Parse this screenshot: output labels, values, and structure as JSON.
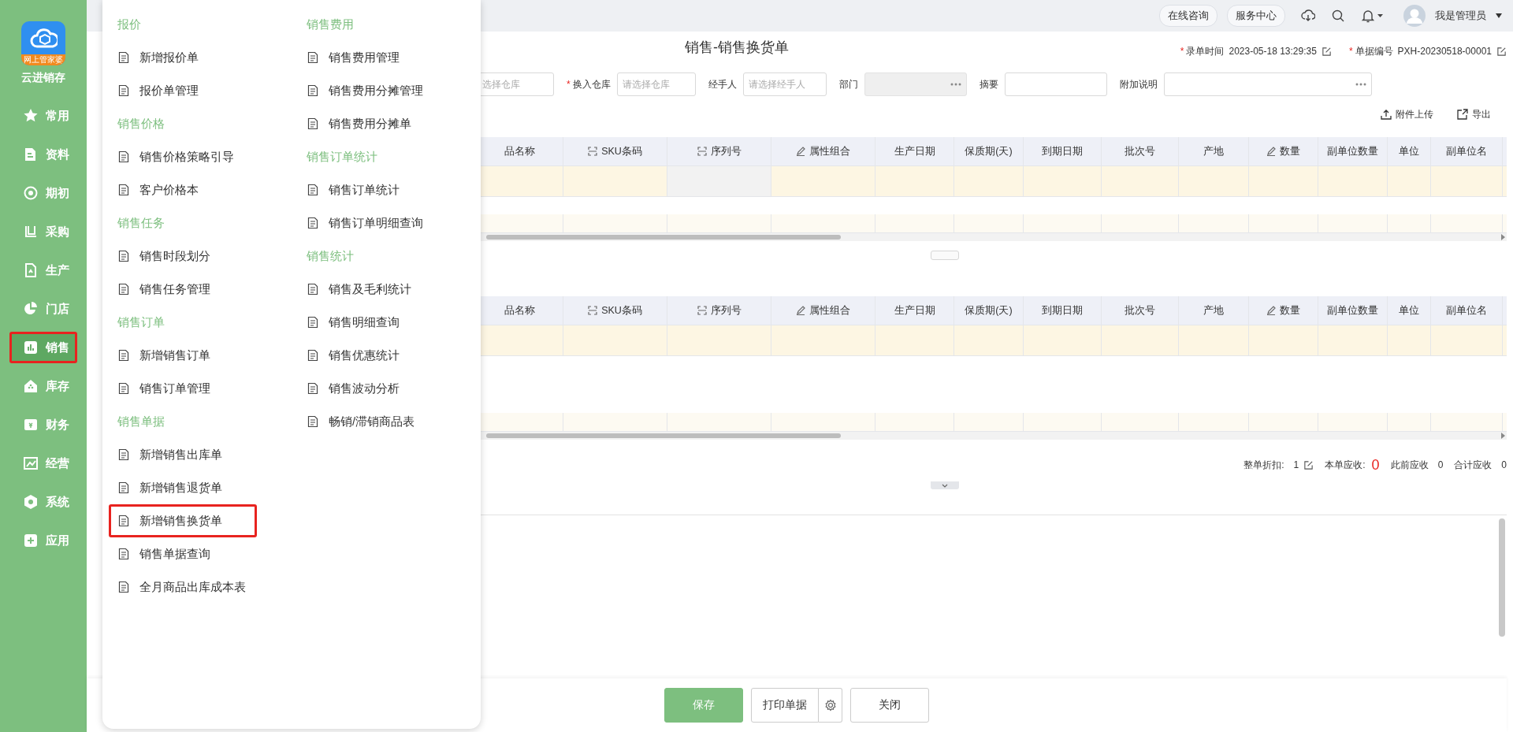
{
  "sidebar": {
    "logo_text": "网上管家婆",
    "brand": "云进销存",
    "items": [
      {
        "label": "常用",
        "selected": false,
        "highlighted": false
      },
      {
        "label": "资料",
        "selected": false,
        "highlighted": false
      },
      {
        "label": "期初",
        "selected": false,
        "highlighted": false
      },
      {
        "label": "采购",
        "selected": false,
        "highlighted": false
      },
      {
        "label": "生产",
        "selected": false,
        "highlighted": false
      },
      {
        "label": "门店",
        "selected": false,
        "highlighted": false
      },
      {
        "label": "销售",
        "selected": true,
        "highlighted": true
      },
      {
        "label": "库存",
        "selected": false,
        "highlighted": false
      },
      {
        "label": "财务",
        "selected": false,
        "highlighted": false
      },
      {
        "label": "经营",
        "selected": false,
        "highlighted": false
      },
      {
        "label": "系统",
        "selected": false,
        "highlighted": false
      },
      {
        "label": "应用",
        "selected": false,
        "highlighted": false
      }
    ]
  },
  "topbar": {
    "buttons": [
      "在线咨询",
      "服务中心"
    ],
    "user": "我是管理员"
  },
  "menu": {
    "columns": [
      {
        "groups": [
          {
            "title": "报价",
            "items": [
              {
                "label": "新增报价单",
                "highlighted": false
              },
              {
                "label": "报价单管理",
                "highlighted": false
              }
            ]
          },
          {
            "title": "销售价格",
            "items": [
              {
                "label": "销售价格策略引导",
                "highlighted": false
              },
              {
                "label": "客户价格本",
                "highlighted": false
              }
            ]
          },
          {
            "title": "销售任务",
            "items": [
              {
                "label": "销售时段划分",
                "highlighted": false
              },
              {
                "label": "销售任务管理",
                "highlighted": false
              }
            ]
          },
          {
            "title": "销售订单",
            "items": [
              {
                "label": "新增销售订单",
                "highlighted": false
              },
              {
                "label": "销售订单管理",
                "highlighted": false
              }
            ]
          },
          {
            "title": "销售单据",
            "items": [
              {
                "label": "新增销售出库单",
                "highlighted": false
              },
              {
                "label": "新增销售退货单",
                "highlighted": false
              },
              {
                "label": "新增销售换货单",
                "highlighted": true
              },
              {
                "label": "销售单据查询",
                "highlighted": false
              },
              {
                "label": "全月商品出库成本表",
                "highlighted": false
              }
            ]
          }
        ]
      },
      {
        "groups": [
          {
            "title": "销售费用",
            "items": [
              {
                "label": "销售费用管理",
                "highlighted": false
              },
              {
                "label": "销售费用分摊管理",
                "highlighted": false
              },
              {
                "label": "销售费用分摊单",
                "highlighted": false
              }
            ]
          },
          {
            "title": "销售订单统计",
            "items": [
              {
                "label": "销售订单统计",
                "highlighted": false
              },
              {
                "label": "销售订单明细查询",
                "highlighted": false
              }
            ]
          },
          {
            "title": "销售统计",
            "items": [
              {
                "label": "销售及毛利统计",
                "highlighted": false
              },
              {
                "label": "销售明细查询",
                "highlighted": false
              },
              {
                "label": "销售优惠统计",
                "highlighted": false
              },
              {
                "label": "销售波动分析",
                "highlighted": false
              },
              {
                "label": "畅销/滞销商品表",
                "highlighted": false
              }
            ]
          }
        ]
      }
    ]
  },
  "form": {
    "title": "销售-销售换货单",
    "meta": [
      {
        "mark": "*",
        "label": "录单时间",
        "value": "2023-05-18 13:29:35"
      },
      {
        "mark": "*",
        "label": "单据编号",
        "value": "PXH-20230518-00001"
      }
    ],
    "fields": [
      {
        "kind": "select",
        "placeholder": "选择仓库"
      },
      {
        "kind": "select",
        "mark": "*",
        "label": "换入仓库",
        "placeholder": "请选择仓库"
      },
      {
        "kind": "select",
        "label": "经手人",
        "placeholder": "请选择经手人"
      },
      {
        "kind": "picker",
        "label": "部门",
        "disabled": true
      },
      {
        "kind": "text",
        "label": "摘要",
        "disabled": false
      },
      {
        "kind": "picker",
        "label": "附加说明",
        "disabled": false
      }
    ],
    "actions": [
      {
        "label": "附件上传",
        "kind": "upload"
      },
      {
        "label": "导出",
        "kind": "export"
      }
    ]
  },
  "tables": [
    {
      "columns": [
        {
          "label": "品名称",
          "kind": "plain"
        },
        {
          "label": "SKU条码",
          "kind": "scan"
        },
        {
          "label": "序列号",
          "kind": "scan"
        },
        {
          "label": "属性组合",
          "kind": "edit"
        },
        {
          "label": "生产日期",
          "kind": "plain"
        },
        {
          "label": "保质期(天)",
          "kind": "plain"
        },
        {
          "label": "到期日期",
          "kind": "plain"
        },
        {
          "label": "批次号",
          "kind": "plain"
        },
        {
          "label": "产地",
          "kind": "plain"
        },
        {
          "label": "数量",
          "kind": "edit"
        },
        {
          "label": "副单位数量",
          "kind": "plain"
        },
        {
          "label": "单位",
          "kind": "plain"
        },
        {
          "label": "副单位名",
          "kind": "plain"
        }
      ]
    },
    {
      "columns": [
        {
          "label": "品名称",
          "kind": "plain"
        },
        {
          "label": "SKU条码",
          "kind": "scan"
        },
        {
          "label": "序列号",
          "kind": "scan"
        },
        {
          "label": "属性组合",
          "kind": "edit"
        },
        {
          "label": "生产日期",
          "kind": "plain"
        },
        {
          "label": "保质期(天)",
          "kind": "plain"
        },
        {
          "label": "到期日期",
          "kind": "plain"
        },
        {
          "label": "批次号",
          "kind": "plain"
        },
        {
          "label": "产地",
          "kind": "plain"
        },
        {
          "label": "数量",
          "kind": "edit"
        },
        {
          "label": "副单位数量",
          "kind": "plain"
        },
        {
          "label": "单位",
          "kind": "plain"
        },
        {
          "label": "副单位名",
          "kind": "plain"
        }
      ]
    }
  ],
  "summary": [
    {
      "label": "整单折扣:",
      "value": "1",
      "kind": "editable"
    },
    {
      "label": "本单应收:",
      "value": "0",
      "kind": "highlight"
    },
    {
      "label": "此前应收",
      "value": "0",
      "kind": "plain"
    },
    {
      "label": "合计应收",
      "value": "0",
      "kind": "plain"
    }
  ],
  "footer": {
    "buttons": [
      {
        "label": "保存",
        "kind": "primary"
      },
      {
        "label": "打印单据",
        "kind": "split"
      },
      {
        "label": "关闭",
        "kind": "default"
      }
    ]
  }
}
